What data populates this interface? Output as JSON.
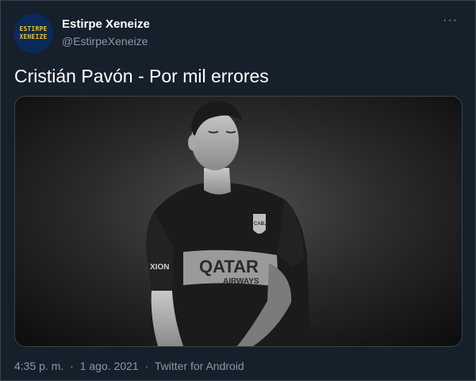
{
  "user": {
    "avatar_line1": "ESTIRPE",
    "avatar_line2": "XENEIZE",
    "display_name": "Estirpe Xeneize",
    "handle": "@EstirpeXeneize"
  },
  "more_label": "···",
  "tweet": {
    "text": "Cristián Pavón - Por mil errores",
    "time": "4:35 p. m.",
    "date": "1 ago. 2021",
    "source": "Twitter for Android",
    "separator": "·"
  },
  "photo": {
    "jersey_sponsor": "QATAR",
    "jersey_sponsor_sub": "AIRWAYS",
    "sleeve_text": "XION",
    "crest_text": "CABJ"
  },
  "colors": {
    "background": "#15202b",
    "text": "#ffffff",
    "secondary": "#8b98a5",
    "border": "#38444d",
    "avatar_bg": "#0b2a5b",
    "avatar_text": "#f3c614"
  }
}
